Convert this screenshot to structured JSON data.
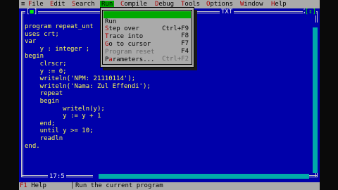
{
  "menu": {
    "system": "≡",
    "items": [
      {
        "hot": "F",
        "rest": "ile"
      },
      {
        "hot": "E",
        "rest": "dit"
      },
      {
        "hot": "S",
        "rest": "earch"
      },
      {
        "hot": "R",
        "rest": "un"
      },
      {
        "hot": "C",
        "rest": "ompile"
      },
      {
        "hot": "D",
        "rest": "ebug"
      },
      {
        "hot": "T",
        "rest": "ools"
      },
      {
        "hot": "O",
        "rest": "ptions"
      },
      {
        "hot": "W",
        "rest": "indow"
      },
      {
        "hot": "H",
        "rest": "elp"
      }
    ]
  },
  "run_menu": {
    "items": [
      {
        "hot": "R",
        "rest": "un",
        "key": "Ctrl+F9"
      },
      {
        "hot": "S",
        "rest": "tep over",
        "key": "F8"
      },
      {
        "hot": "T",
        "rest": "race into",
        "key": "F7"
      },
      {
        "hot": "G",
        "rest": "o to cursor",
        "key": "F4"
      },
      {
        "hot": "",
        "rest": "Program reset",
        "key": "Ctrl+F2"
      },
      {
        "pre": "P",
        "hot": "a",
        "rest": "rameters...",
        "key": ""
      }
    ]
  },
  "editor": {
    "close_left": "[",
    "close_mark": "■",
    "close_right": "]",
    "title": "TXT",
    "window_number": "2",
    "zoom": "[↕]",
    "cursor_position": "17:5",
    "code_lines": [
      "program repeat_unt",
      "uses crt;",
      "var",
      "    y : integer ;",
      "begin",
      "    clrscr;",
      "    y := 0;",
      "    writeln('NPM: 21110114');",
      "    writeln('Nama: Zul Effendi');",
      "    repeat",
      "    begin",
      "          writeln(y);",
      "          y := y + 1",
      "    end;",
      "    until y >= 10;",
      "    readln",
      "end."
    ]
  },
  "status": {
    "f1_key": "F1",
    "help_label": " Help",
    "separator": "│",
    "message": "Run the current program"
  },
  "colors": {
    "background": "#0000aa",
    "code_text": "#ffff55",
    "menu_bar": "#aaaaaa",
    "highlight": "#00aa00",
    "hotkey": "#aa0000"
  }
}
